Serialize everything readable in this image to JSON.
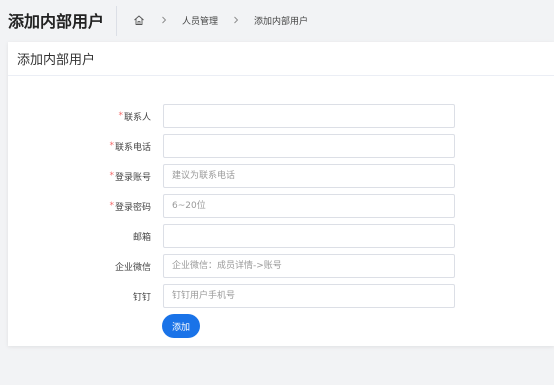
{
  "app": {
    "title": "添加内部用户"
  },
  "breadcrumb": {
    "home_icon": "home-icon",
    "items": [
      "人员管理",
      "添加内部用户"
    ]
  },
  "card": {
    "title": "添加内部用户"
  },
  "form": {
    "fields": [
      {
        "label": "联系人",
        "required": true,
        "value": "",
        "placeholder": ""
      },
      {
        "label": "联系电话",
        "required": true,
        "value": "",
        "placeholder": ""
      },
      {
        "label": "登录账号",
        "required": true,
        "value": "",
        "placeholder": "建议为联系电话"
      },
      {
        "label": "登录密码",
        "required": true,
        "value": "",
        "placeholder": "6~20位"
      },
      {
        "label": "邮箱",
        "required": false,
        "value": "",
        "placeholder": ""
      },
      {
        "label": "企业微信",
        "required": false,
        "value": "",
        "placeholder": "企业微信：成员详情->账号"
      },
      {
        "label": "钉钉",
        "required": false,
        "value": "",
        "placeholder": "钉钉用户手机号"
      }
    ],
    "required_mark": "*",
    "submit_label": "添加"
  },
  "colors": {
    "accent": "#1a73e8",
    "required": "#f56c6c",
    "background": "#f2f3f5"
  }
}
